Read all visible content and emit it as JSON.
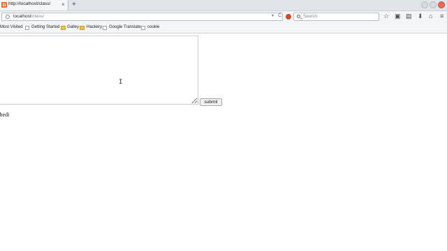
{
  "tab": {
    "title": "http://localhost/class/",
    "close": "×",
    "new_tab": "+"
  },
  "address_bar": {
    "host": "localhost",
    "path": "/class/",
    "dropdown": "▾",
    "reload": "C"
  },
  "search": {
    "placeholder": "Search"
  },
  "toolbar_icons": [
    "☆",
    "▣",
    "▤",
    "⬇",
    "⌂",
    "≡"
  ],
  "bookmarks": {
    "most_visited": "Most Visited",
    "items": [
      {
        "label": "Getting Started",
        "icon": "page"
      },
      {
        "label": "Galley",
        "icon": "folder"
      },
      {
        "label": "Hackery",
        "icon": "folder"
      },
      {
        "label": "Google Translate",
        "icon": "page"
      },
      {
        "label": "cookie",
        "icon": "page"
      }
    ]
  },
  "form": {
    "textarea_value": "",
    "submit_label": "submit"
  },
  "output": {
    "text": "ehedi"
  },
  "colors": {
    "accent_favicon": "#e8692c",
    "close_button": "#e86b5b"
  }
}
